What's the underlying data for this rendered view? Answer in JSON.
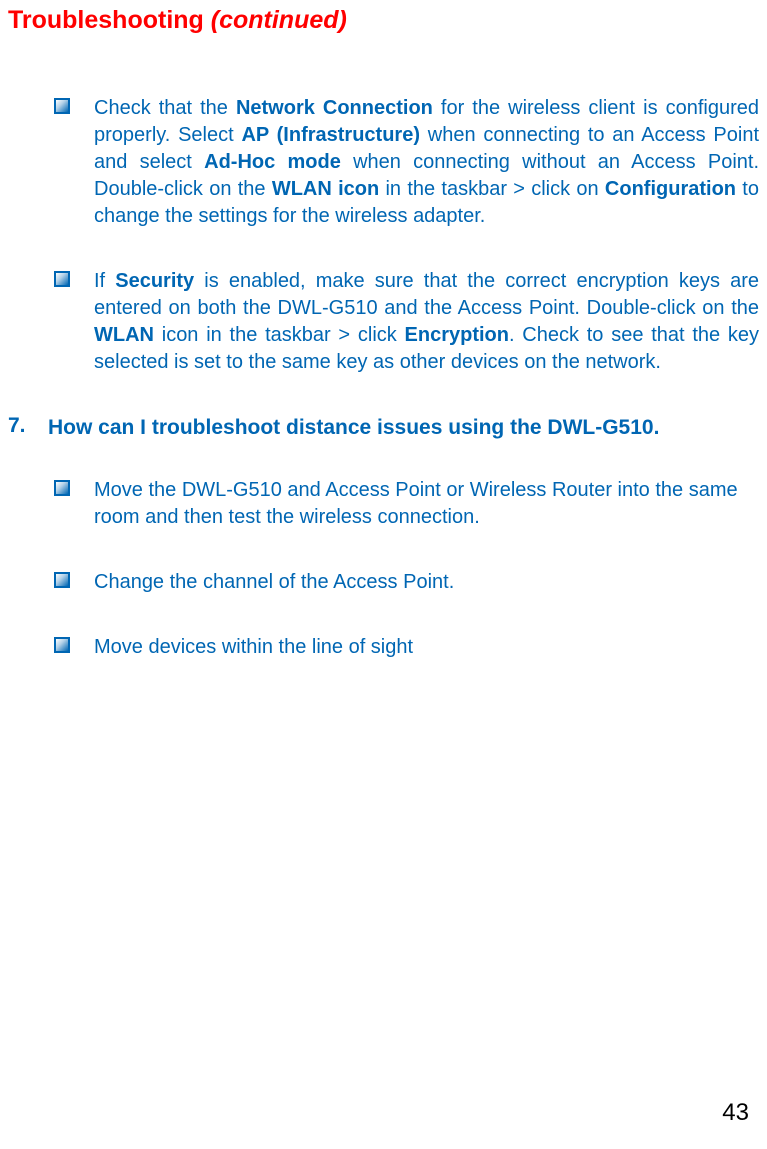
{
  "header": {
    "title": "Troubleshooting ",
    "continued": "(continued)"
  },
  "bullets_a": {
    "item1": {
      "t1": "Check that the ",
      "t2": "Network Connection",
      "t3": " for the wireless client is configured properly. Select ",
      "t4": "AP (Infrastructure)",
      "t5": " when connecting to an Access Point and select ",
      "t6": "Ad-Hoc mode",
      "t7": " when connecting without an  Access Point. Double-click on the ",
      "t8": "WLAN icon",
      "t9": " in the taskbar > click on ",
      "t10": "Configuration",
      "t11": " to change the settings for the wireless adapter."
    },
    "item2": {
      "t1": "If ",
      "t2": "Security",
      "t3": " is enabled, make sure that the correct encryption keys are entered on both the DWL-G510 and the Access Point. Double-click on the ",
      "t4": "WLAN",
      "t5": " icon in the taskbar > click ",
      "t6": "Encryption",
      "t7": ". Check to see that the key selected is set to the same key as other devices on the network."
    }
  },
  "question": {
    "number": "7.",
    "text": "How can I troubleshoot distance issues using the DWL-G510."
  },
  "bullets_b": {
    "item1": "Move the DWL-G510 and Access Point or Wireless Router into the same room and then test the wireless connection.",
    "item2": "Change the channel of the Access Point.",
    "item3": "Move devices within the line of sight"
  },
  "page_number": "43"
}
